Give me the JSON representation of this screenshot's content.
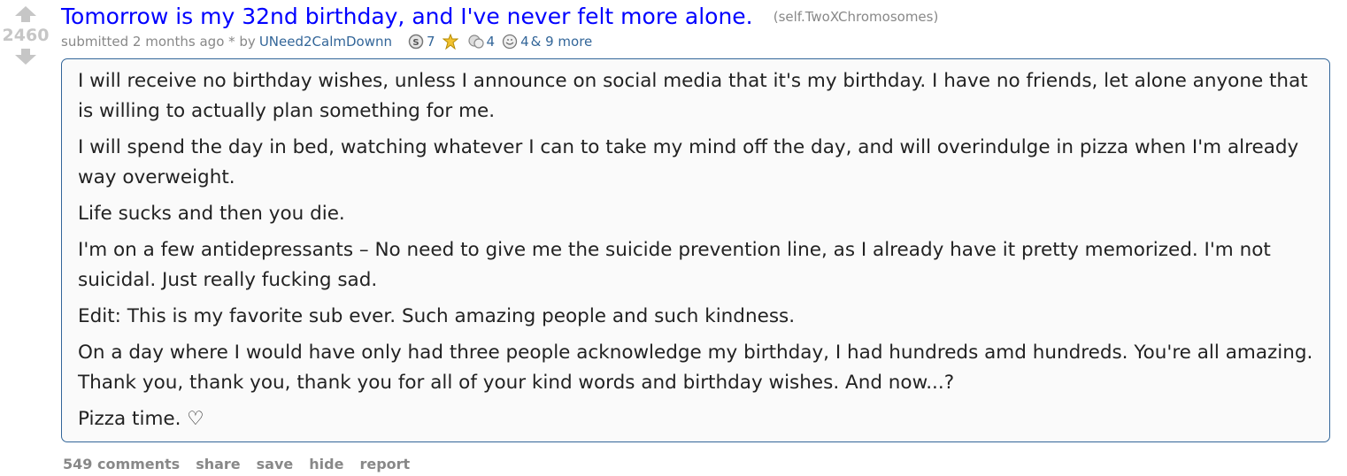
{
  "post": {
    "score": "2460",
    "title": "Tomorrow is my 32nd birthday, and I've never felt more alone.",
    "domain": "(self.TwoXChromosomes)",
    "submitted": "submitted 2 months ago * by",
    "author": "UNeed2CalmDownn",
    "awards": [
      {
        "icon": "silver-award-icon",
        "count": "7"
      },
      {
        "icon": "gold-award-icon",
        "count": ""
      },
      {
        "icon": "wholesome-award-icon",
        "count": "4"
      },
      {
        "icon": "helpful-award-icon",
        "count": "4"
      }
    ],
    "more_awards": "& 9 more",
    "body": [
      "I will receive no birthday wishes, unless I announce on social media that it's my birthday. I have no friends, let alone anyone that is willing to actually plan something for me.",
      "I will spend the day in bed, watching whatever I can to take my mind off the day, and will overindulge in pizza when I'm already way overweight.",
      "Life sucks and then you die.",
      "I'm on a few antidepressants – No need to give me the suicide prevention line, as I already have it pretty memorized. I'm not suicidal. Just really fucking sad.",
      "Edit: This is my favorite sub ever. Such amazing people and such kindness.",
      "On a day where I would have only had three people acknowledge my birthday, I had hundreds amd hundreds. You're all amazing. Thank you, thank you, thank you for all of your kind words and birthday wishes. And now...?",
      "Pizza time. ♡"
    ]
  },
  "buttons": {
    "comments": "549 comments",
    "share": "share",
    "save": "save",
    "hide": "hide",
    "report": "report"
  }
}
